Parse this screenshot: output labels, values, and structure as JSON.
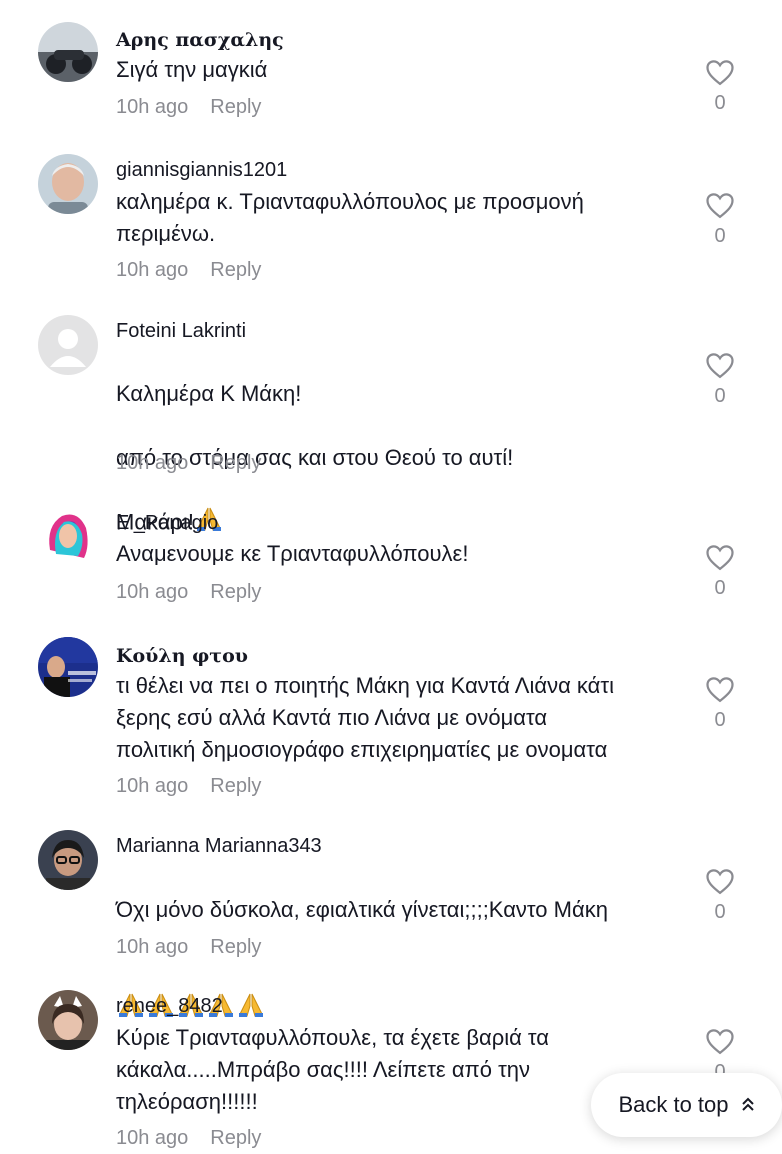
{
  "comments": [
    {
      "username": "Αρης πασχαλης",
      "text": "Σιγά την μαγκιά",
      "time": "10h ago",
      "reply": "Reply",
      "likes": "0"
    },
    {
      "username": "giannisgiannis1201",
      "text": "καλημέρα κ. Τριανταφυλλόπουλος με προσμονή\nπεριμένω.",
      "time": "10h ago",
      "reply": "Reply",
      "likes": "0"
    },
    {
      "username": "Foteini Lakrinti",
      "text_lines": [
        "Καλημέρα Κ Μάκη!",
        "από το στόμα σας και στου Θεού το αυτί!",
        "Μακάρι!"
      ],
      "time": "10h ago",
      "reply": "Reply",
      "likes": "0"
    },
    {
      "username": "El_Panagio",
      "text": "Αναμενουμε κε Τριανταφυλλόπουλε!",
      "time": "10h ago",
      "reply": "Reply",
      "likes": "0"
    },
    {
      "username": "Κούλη φτου",
      "text": "τι θέλει να πει ο ποιητής Μάκη για Καντά Λιάνα κάτι\nξερης εσύ αλλά Καντά πιο Λιάνα με ονόματα\nπολιτική δημοσιογράφο επιχειρηματίες με ονοματα",
      "time": "10h ago",
      "reply": "Reply",
      "likes": "0"
    },
    {
      "username": "Marianna Marianna343",
      "text": "Όχι μόνο δύσκολα, εφιαλτικά γίνεται;;;;Καντο Μάκη",
      "time": "10h ago",
      "reply": "Reply",
      "likes": "0"
    },
    {
      "username": "renee_8482",
      "text": "Κύριε Τριανταφυλλόπουλε, τα έχετε βαριά τα\nκάκαλα.....Μπράβο σας!!!! Λείπετε από την\nτηλεόραση!!!!!!",
      "time": "10h ago",
      "reply": "Reply",
      "likes": "0"
    }
  ],
  "back_to_top": "Back to top",
  "icons": {
    "like": "heart-outline-icon",
    "pray": "folded-hands-emoji",
    "back_to_top": "double-chevron-up-icon"
  },
  "colors": {
    "text": "#161823",
    "muted": "#8a8b91",
    "emoji": "#f6b932"
  }
}
